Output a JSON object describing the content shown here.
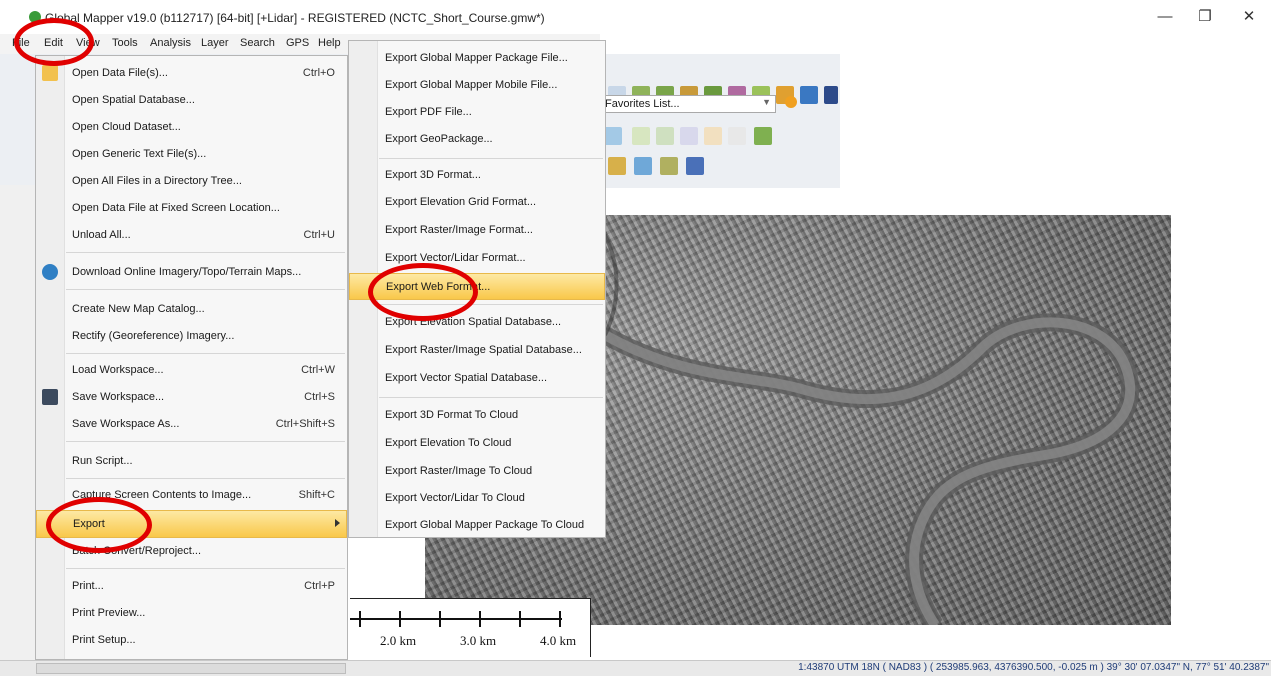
{
  "window": {
    "title": "Global Mapper v19.0 (b112717) [64-bit] [+Lidar] - REGISTERED (NCTC_Short_Course.gmw*)",
    "controls": {
      "minimize": "—",
      "restore": "❐",
      "close": "✕"
    }
  },
  "menubar": [
    "File",
    "Edit",
    "View",
    "Tools",
    "Analysis",
    "Layer",
    "Search",
    "GPS",
    "Help"
  ],
  "toolbar": {
    "favorites_select": "Favorites List..."
  },
  "file_menu": {
    "items": [
      {
        "label": "Open Data File(s)...",
        "shortcut": "Ctrl+O",
        "icon": "folder-icon"
      },
      {
        "label": "Open Spatial Database...",
        "shortcut": ""
      },
      {
        "label": "Open Cloud Dataset...",
        "shortcut": ""
      },
      {
        "label": "Open Generic Text File(s)...",
        "shortcut": ""
      },
      {
        "label": "Open All Files in a Directory Tree...",
        "shortcut": ""
      },
      {
        "label": "Open Data File at Fixed Screen Location...",
        "shortcut": ""
      },
      {
        "label": "Unload All...",
        "shortcut": "Ctrl+U"
      },
      {
        "label": "Download Online Imagery/Topo/Terrain Maps...",
        "shortcut": "",
        "icon": "globe-icon"
      },
      {
        "label": "Create New Map Catalog...",
        "shortcut": ""
      },
      {
        "label": "Rectify (Georeference) Imagery...",
        "shortcut": ""
      },
      {
        "label": "Load Workspace...",
        "shortcut": "Ctrl+W"
      },
      {
        "label": "Save Workspace...",
        "shortcut": "Ctrl+S",
        "icon": "save-icon"
      },
      {
        "label": "Save Workspace As...",
        "shortcut": "Ctrl+Shift+S"
      },
      {
        "label": "Run Script...",
        "shortcut": ""
      },
      {
        "label": "Capture Screen Contents to Image...",
        "shortcut": "Shift+C"
      },
      {
        "label": "Export",
        "shortcut": ""
      },
      {
        "label": "Batch Convert/Reproject...",
        "shortcut": ""
      },
      {
        "label": "Print...",
        "shortcut": "Ctrl+P"
      },
      {
        "label": "Print Preview...",
        "shortcut": ""
      },
      {
        "label": "Print Setup...",
        "shortcut": ""
      }
    ]
  },
  "export_submenu": {
    "items": [
      "Export Global Mapper Package File...",
      "Export Global Mapper Mobile File...",
      "Export PDF File...",
      "Export GeoPackage...",
      "Export 3D Format...",
      "Export Elevation Grid Format...",
      "Export Raster/Image Format...",
      "Export Vector/Lidar Format...",
      "Export Web Format...",
      "Export Elevation Spatial Database...",
      "Export Raster/Image Spatial Database...",
      "Export Vector Spatial Database...",
      "Export 3D Format To Cloud",
      "Export Elevation To Cloud",
      "Export Raster/Image To Cloud",
      "Export Vector/Lidar To Cloud",
      "Export Global Mapper Package To Cloud"
    ],
    "highlighted": "Export Web Format..."
  },
  "scale_bar": {
    "labels": [
      "2.0 km",
      "3.0 km",
      "4.0 km"
    ]
  },
  "status_bar": {
    "text": "1:43870  UTM 18N ( NAD83 ) ( 253985.963, 4376390.500, -0.025 m )  39° 30' 07.0347\" N, 77° 51' 40.2387\""
  },
  "colors": {
    "highlight": "#f9c84a",
    "annotation": "#e00000",
    "status_text": "#1f3c78"
  }
}
